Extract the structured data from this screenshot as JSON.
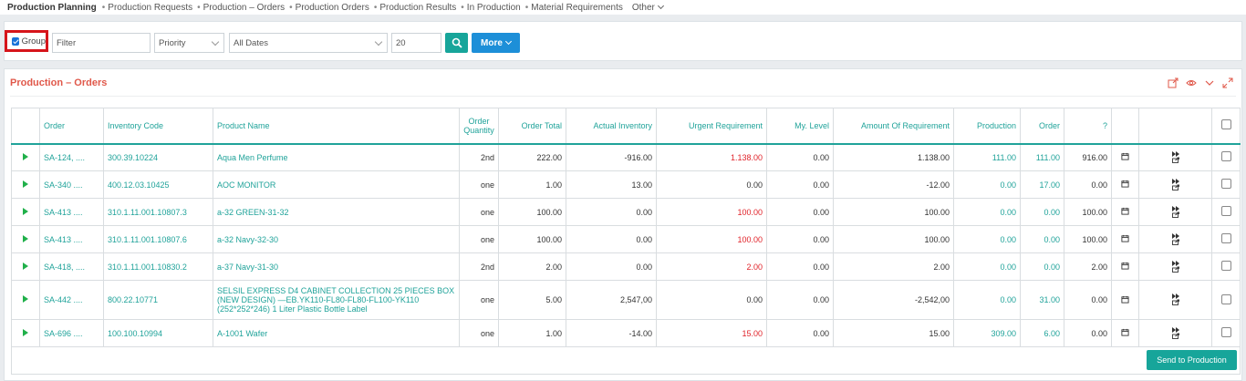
{
  "nav": {
    "brand": "Production Planning",
    "items": [
      "Production Requests",
      "Production – Orders",
      "Production Orders",
      "Production Results",
      "In Production",
      "Material Requirements"
    ],
    "other": "Other"
  },
  "filters": {
    "group_label": "Group",
    "group_checked": true,
    "filter_placeholder": "Filter",
    "priority_value": "Priority",
    "dates_value": "All Dates",
    "count_value": "20",
    "more_label": "More"
  },
  "panel": {
    "title": "Production – Orders",
    "send_label": "Send to Production"
  },
  "columns": [
    "Order",
    "Inventory Code",
    "Product Name",
    "Order Quantity",
    "Order Total",
    "Actual Inventory",
    "Urgent Requirement",
    "My. Level",
    "Amount Of Requirement",
    "Production",
    "Order",
    "?"
  ],
  "rows": [
    {
      "order": "SA-124, ....",
      "code": "300.39.10224",
      "name": "Aqua Men Perfume",
      "qty": "2nd",
      "total": "222.00",
      "actual": "-916.00",
      "urgent": "1.138.00",
      "level": "0.00",
      "amount": "1.138.00",
      "production": "111.00",
      "ord": "111.00",
      "q": "916.00"
    },
    {
      "order": "SA-340 ....",
      "code": "400.12.03.10425",
      "name": "AOC MONITOR",
      "qty": "one",
      "total": "1.00",
      "actual": "13.00",
      "urgent": "0.00",
      "level": "0.00",
      "amount": "-12.00",
      "production": "0.00",
      "ord": "17.00",
      "q": "0.00"
    },
    {
      "order": "SA-413 ....",
      "code": "310.1.11.001.10807.3",
      "name": "a-32 GREEN-31-32",
      "qty": "one",
      "total": "100.00",
      "actual": "0.00",
      "urgent": "100.00",
      "level": "0.00",
      "amount": "100.00",
      "production": "0.00",
      "ord": "0.00",
      "q": "100.00"
    },
    {
      "order": "SA-413 ....",
      "code": "310.1.11.001.10807.6",
      "name": "a-32 Navy-32-30",
      "qty": "one",
      "total": "100.00",
      "actual": "0.00",
      "urgent": "100.00",
      "level": "0.00",
      "amount": "100.00",
      "production": "0.00",
      "ord": "0.00",
      "q": "100.00"
    },
    {
      "order": "SA-418, ....",
      "code": "310.1.11.001.10830.2",
      "name": "a-37 Navy-31-30",
      "qty": "2nd",
      "total": "2.00",
      "actual": "0.00",
      "urgent": "2.00",
      "level": "0.00",
      "amount": "2.00",
      "production": "0.00",
      "ord": "0.00",
      "q": "2.00"
    },
    {
      "order": "SA-442 ....",
      "code": "800.22.10771",
      "name": "SELSIL EXPRESS D4 CABINET COLLECTION 25 PIECES BOX (NEW DESIGN) —EB.YK110-FL80-FL80-FL100-YK110 (252*252*246) 1 Liter Plastic Bottle Label",
      "qty": "one",
      "total": "5.00",
      "actual": "2,547,00",
      "urgent": "0.00",
      "level": "0.00",
      "amount": "-2,542,00",
      "production": "0.00",
      "ord": "31.00",
      "q": "0.00"
    },
    {
      "order": "SA-696 ....",
      "code": "100.100.10994",
      "name": "A-1001 Wafer",
      "qty": "one",
      "total": "1.00",
      "actual": "-14.00",
      "urgent": "15.00",
      "level": "0.00",
      "amount": "15.00",
      "production": "309.00",
      "ord": "6.00",
      "q": "0.00"
    }
  ],
  "colors": {
    "teal": "#20a39a",
    "red": "#e0232a",
    "accent": "#e0584a",
    "button_blue": "#1d8fd8",
    "highlight": "#d6151b"
  }
}
